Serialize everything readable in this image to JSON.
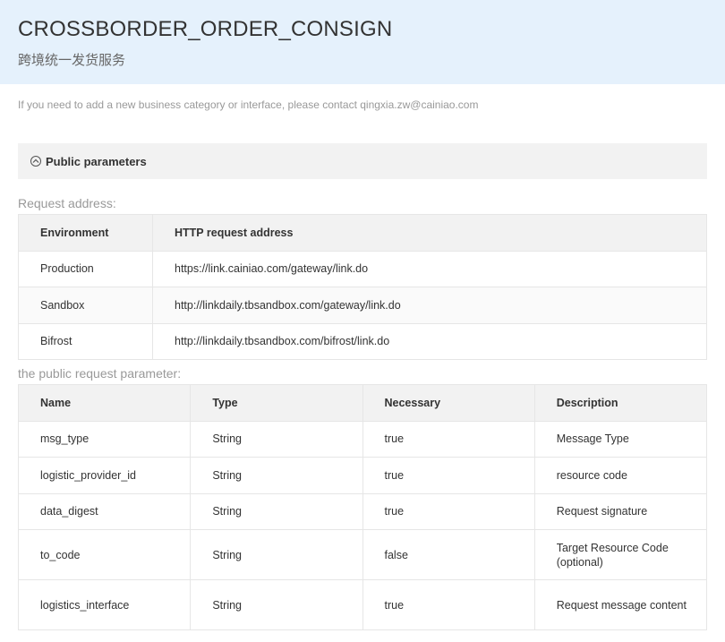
{
  "header": {
    "title": "CROSSBORDER_ORDER_CONSIGN",
    "subtitle": "跨境统一发货服务"
  },
  "notice": "If you need to add a new business category or interface, please contact qingxia.zw@cainiao.com",
  "section": {
    "label": "Public parameters",
    "icon": "chevron-up-circle-icon"
  },
  "request_address": {
    "caption": "Request address:",
    "headers": [
      "Environment",
      "HTTP request address"
    ],
    "rows": [
      [
        "Production",
        "https://link.cainiao.com/gateway/link.do"
      ],
      [
        "Sandbox",
        "http://linkdaily.tbsandbox.com/gateway/link.do"
      ],
      [
        "Bifrost",
        "http://linkdaily.tbsandbox.com/bifrost/link.do"
      ]
    ]
  },
  "public_params": {
    "caption": "the public request parameter:",
    "headers": [
      "Name",
      "Type",
      "Necessary",
      "Description"
    ],
    "rows": [
      [
        "msg_type",
        "String",
        "true",
        "Message Type"
      ],
      [
        "logistic_provider_id",
        "String",
        "true",
        "resource code"
      ],
      [
        "data_digest",
        "String",
        "true",
        "Request signature"
      ],
      [
        "to_code",
        "String",
        "false",
        "Target Resource Code (optional)"
      ],
      [
        "logistics_interface",
        "String",
        "true",
        "Request message content"
      ]
    ]
  }
}
